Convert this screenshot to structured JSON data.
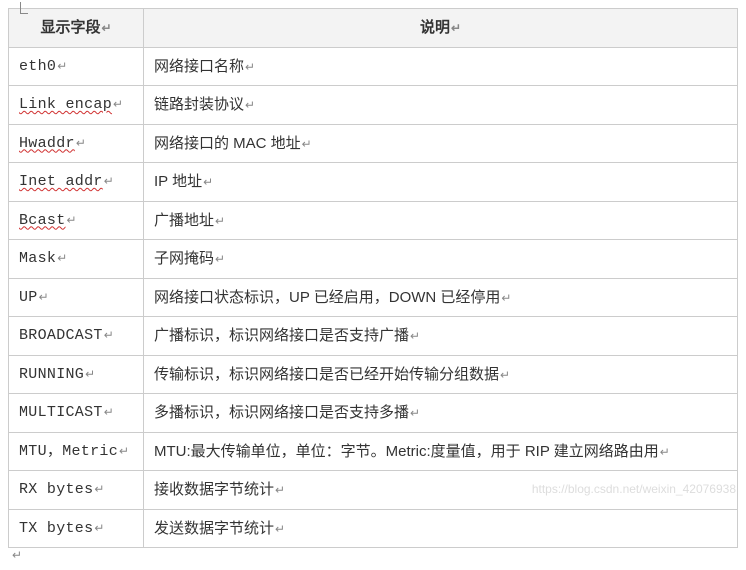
{
  "headers": {
    "field": "显示字段",
    "desc": "说明"
  },
  "rows": [
    {
      "field": "eth0",
      "wavy": false,
      "desc": "网络接口名称"
    },
    {
      "field": "Link encap",
      "wavy": true,
      "desc": "链路封装协议"
    },
    {
      "field": "Hwaddr",
      "wavy": true,
      "desc": "网络接口的 MAC 地址"
    },
    {
      "field": "Inet addr",
      "wavy": true,
      "desc": "IP 地址"
    },
    {
      "field": "Bcast",
      "wavy": true,
      "desc": "广播地址"
    },
    {
      "field": "Mask",
      "wavy": false,
      "desc": "子网掩码"
    },
    {
      "field": "UP",
      "wavy": false,
      "desc": "网络接口状态标识，UP 已经启用，DOWN 已经停用"
    },
    {
      "field": "BROADCAST",
      "wavy": false,
      "desc": "广播标识，标识网络接口是否支持广播"
    },
    {
      "field": "RUNNING",
      "wavy": false,
      "desc": "传输标识，标识网络接口是否已经开始传输分组数据"
    },
    {
      "field": "MULTICAST",
      "wavy": false,
      "desc": "多播标识，标识网络接口是否支持多播"
    },
    {
      "field": "MTU，Metric",
      "wavy": false,
      "desc": "MTU:最大传输单位，单位：字节。Metric:度量值，用于 RIP 建立网络路由用"
    },
    {
      "field": "RX bytes",
      "wavy": false,
      "desc": "接收数据字节统计"
    },
    {
      "field": "TX bytes",
      "wavy": false,
      "desc": "发送数据字节统计"
    }
  ],
  "return_mark": "↵",
  "watermark": "https://blog.csdn.net/weixin_42076938"
}
